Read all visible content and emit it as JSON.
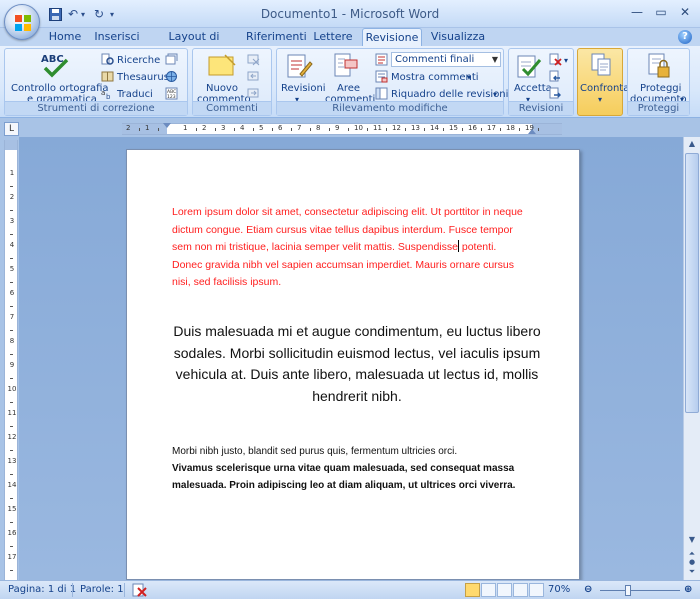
{
  "window": {
    "title": "Documento1 - Microsoft Word"
  },
  "tabs": [
    "Home",
    "Inserisci",
    "Layout di pagina",
    "Riferimenti",
    "Lettere",
    "Revisione",
    "Visualizza"
  ],
  "active_tab": "Revisione",
  "ribbon": {
    "proofing": {
      "spelling_line1": "Controllo ortografia",
      "spelling_line2": "e grammatica",
      "research": "Ricerche",
      "thesaurus": "Thesaurus",
      "translate": "Traduci",
      "group_label": "Strumenti di correzione",
      "abc_text": "ABC"
    },
    "comments": {
      "new_line1": "Nuovo",
      "new_line2": "commento",
      "group_label": "Commenti"
    },
    "tracking": {
      "revisions": "Revisioni",
      "balloons_line1": "Aree",
      "balloons_line2": "commenti",
      "display_combo": "Commenti finali",
      "show_markup": "Mostra commenti",
      "reviewing_pane": "Riquadro delle revisioni",
      "group_label": "Rilevamento modifiche"
    },
    "changes": {
      "accept": "Accetta",
      "group_label": "Revisioni"
    },
    "compare": {
      "compare": "Confronta"
    },
    "protect": {
      "protect_line1": "Proteggi",
      "protect_line2": "documento",
      "group_label": "Proteggi"
    }
  },
  "ruler": {
    "h_numbers": [
      "2",
      "1",
      "1",
      "2",
      "3",
      "4",
      "5",
      "6",
      "7",
      "8",
      "9",
      "10",
      "11",
      "12",
      "13",
      "14",
      "15",
      "16",
      "17",
      "18",
      "19"
    ],
    "v_numbers": [
      "1",
      "1",
      "2",
      "3",
      "4",
      "5",
      "6",
      "7",
      "8",
      "9",
      "10",
      "11",
      "12",
      "13",
      "14",
      "15",
      "16",
      "17"
    ]
  },
  "document": {
    "para1": "Lorem ipsum dolor sit amet, consectetur adipiscing elit. Ut porttitor in neque dictum congue. Etiam cursus vitae tellus dapibus interdum. Fusce tempor sem non mi tristique, lacinia semper velit mattis. Suspendisse",
    "para1_rest": "potenti. Donec gravida nibh vel sapien accumsan imperdiet. Mauris ornare cursus nisi, sed facilisis ipsum.",
    "para2": "Duis malesuada mi et augue condimentum, eu luctus libero sodales. Morbi sollicitudin euismod lectus, vel iaculis ipsum vehicula at. Duis ante libero, malesuada ut lectus id, mollis hendrerit nibh.",
    "para3_normal": "Morbi nibh justo, blandit sed purus quis, fermentum ultricies orci.",
    "para3_bold": "Vivamus scelerisque urna vitae quam malesuada, sed consequat massa malesuada. Proin adipiscing leo at diam aliquam, ut ultrices orci viverra."
  },
  "status": {
    "page": "Pagina: 1 di 1",
    "words": "Parole: 1",
    "zoom": "70%",
    "zoom_fraction": 0.35
  },
  "colors": {
    "tracked_text": "#ff2020",
    "ribbon_accent": "#15428b"
  }
}
